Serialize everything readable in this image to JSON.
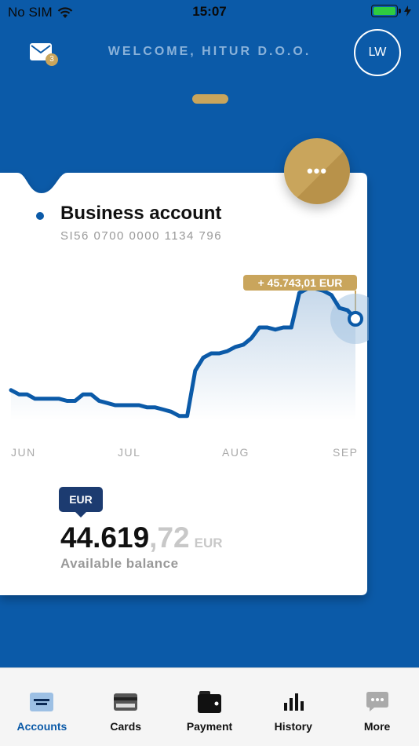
{
  "status_bar": {
    "carrier": "No SIM",
    "time": "15:07",
    "icons": [
      "wifi-icon",
      "battery-icon",
      "charging-icon"
    ]
  },
  "header": {
    "welcome": "WELCOME, HITUR D.O.O.",
    "mail_badge": "3",
    "avatar_initials": "LW"
  },
  "more_button_label": "•••",
  "account": {
    "name": "Business account",
    "iban": "SI56 0700 0000 1134 796"
  },
  "chart_data": {
    "type": "area",
    "title": "",
    "x": [
      "JUN",
      "JUL",
      "AUG",
      "SEP"
    ],
    "series": [
      {
        "values": [
          41.3,
          41.1,
          41.1,
          40.9,
          40.9,
          40.9,
          40.9,
          40.8,
          40.8,
          41.1,
          41.1,
          40.8,
          40.7,
          40.6,
          40.6,
          40.6,
          40.6,
          40.5,
          40.5,
          40.4,
          40.3,
          40.1,
          40.1,
          42.2,
          42.8,
          43.0,
          43.0,
          43.1,
          43.3,
          43.4,
          43.7,
          44.2,
          44.2,
          44.1,
          44.2,
          44.2,
          45.8,
          46.0,
          46.0,
          45.9,
          45.7,
          45.1,
          45.0,
          44.6
        ]
      }
    ],
    "highlight": {
      "label": "+ 45.743,01  EUR"
    },
    "ylim": [
      39,
      47
    ],
    "grid": false,
    "colors": {
      "line": "#0b5aa8",
      "fill_top": "#c6d8ea",
      "fill_bottom": "#ffffff",
      "highlight": "#c9a55c"
    }
  },
  "balance": {
    "currency_tag": "EUR",
    "integer": "44.619",
    "decimal": ",72",
    "currency": "EUR",
    "label": "Available balance"
  },
  "tabbar": {
    "active_color": "#0b5aa8",
    "items": [
      {
        "label": "Accounts",
        "icon": "accounts-icon",
        "active": true
      },
      {
        "label": "Cards",
        "icon": "card-icon",
        "active": false
      },
      {
        "label": "Payment",
        "icon": "wallet-icon",
        "active": false
      },
      {
        "label": "History",
        "icon": "bar-chart-icon",
        "active": false
      },
      {
        "label": "More",
        "icon": "chat-dots-icon",
        "active": false
      }
    ]
  }
}
